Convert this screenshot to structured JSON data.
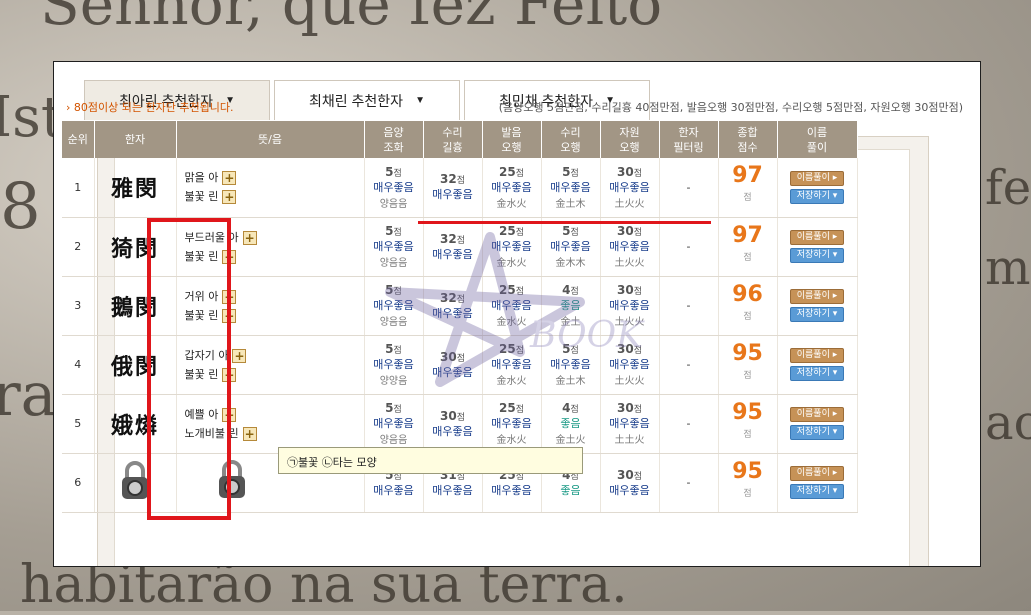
{
  "tabs": [
    {
      "label": "최아린 추천한자",
      "active": true
    },
    {
      "label": "최채린 추천한자",
      "active": false
    },
    {
      "label": "최민채 추천한자",
      "active": false
    }
  ],
  "notice": "› 80점이상 되는 한자단 추천됩니다.",
  "score_note": "(음양오행 5점만점, 수리길흉 40점만점, 발음오행 30점만점, 수리오행 5점만점, 자원오행 30점만점)",
  "headers": {
    "rank": "순위",
    "hanja": "한자",
    "meaning": "뜻/음",
    "c1a": "음양",
    "c1b": "조화",
    "c2a": "수리",
    "c2b": "길흉",
    "c3a": "발음",
    "c3b": "오행",
    "c4a": "수리",
    "c4b": "오행",
    "c5a": "자원",
    "c5b": "오행",
    "c6a": "한자",
    "c6b": "필터링",
    "c7a": "종합",
    "c7b": "점수",
    "c8a": "이름",
    "c8b": "풀이"
  },
  "rows": [
    {
      "rank": "1",
      "hanja": "雅閔",
      "m1": "맑을 아",
      "m2": "불꽃 린",
      "s1": "5",
      "s1l": "매우좋음",
      "s1s": "양음음",
      "s2": "32",
      "s2l": "매우좋음",
      "s2s": "",
      "s3": "25",
      "s3l": "매우좋음",
      "s3s": "金水火",
      "s4": "5",
      "s4l": "매우좋음",
      "s4s": "金土木",
      "s5": "30",
      "s5l": "매우좋음",
      "s5s": "土火火",
      "filter": "-",
      "total": "97"
    },
    {
      "rank": "2",
      "hanja": "猗閔",
      "m1": "부드러울 아",
      "m2": "불꽃 린",
      "s1": "5",
      "s1l": "매우좋음",
      "s1s": "양음음",
      "s2": "32",
      "s2l": "매우좋음",
      "s2s": "",
      "s3": "25",
      "s3l": "매우좋음",
      "s3s": "金水火",
      "s4": "5",
      "s4l": "매우좋음",
      "s4s": "金木木",
      "s5": "30",
      "s5l": "매우좋음",
      "s5s": "土火火",
      "filter": "-",
      "total": "97"
    },
    {
      "rank": "3",
      "hanja": "鵝閔",
      "m1": "거위 아",
      "m2": "불꽃 린",
      "s1": "5",
      "s1l": "매우좋음",
      "s1s": "양음음",
      "s2": "32",
      "s2l": "매우좋음",
      "s2s": "",
      "s3": "25",
      "s3l": "매우좋음",
      "s3s": "金水火",
      "s4": "4",
      "s4l": "좋음",
      "s4s": "金土",
      "s5": "30",
      "s5l": "매우좋음",
      "s5s": "土火火",
      "filter": "-",
      "total": "96"
    },
    {
      "rank": "4",
      "hanja": "俄閔",
      "m1": "갑자기 아",
      "m2": "불꽃 린",
      "s1": "5",
      "s1l": "매우좋음",
      "s1s": "양양음",
      "s2": "30",
      "s2l": "매우좋음",
      "s2s": "",
      "s3": "25",
      "s3l": "매우좋음",
      "s3s": "金水火",
      "s4": "5",
      "s4l": "매우좋음",
      "s4s": "金土木",
      "s5": "30",
      "s5l": "매우좋음",
      "s5s": "土火火",
      "filter": "-",
      "total": "95"
    },
    {
      "rank": "5",
      "hanja": "娥燐",
      "m1": "예쁠 아",
      "m2": "노개비불 린",
      "s1": "5",
      "s1l": "매우좋음",
      "s1s": "양음음",
      "s2": "30",
      "s2l": "매우좋음",
      "s2s": "",
      "s3": "25",
      "s3l": "매우좋음",
      "s3s": "金水火",
      "s4": "4",
      "s4l": "좋음",
      "s4s": "金土火",
      "s5": "30",
      "s5l": "매우좋음",
      "s5s": "土土火",
      "filter": "-",
      "total": "95"
    },
    {
      "rank": "6",
      "hanja": "",
      "m1": "",
      "m2": "",
      "s1": "5",
      "s1l": "매우좋음",
      "s1s": "",
      "s2": "31",
      "s2l": "매우좋음",
      "s2s": "",
      "s3": "25",
      "s3l": "매우좋음",
      "s3s": "",
      "s4": "4",
      "s4l": "좋음",
      "s4s": "",
      "s5": "30",
      "s5l": "매우좋음",
      "s5s": "",
      "filter": "-",
      "total": "95"
    }
  ],
  "point_unit": "점",
  "btn_name": "이름풀이 ▸",
  "btn_save": "저장하기 ▾",
  "tooltip": "㉠불꽃 ㉡타는 모양",
  "watermark_text": "BOOK",
  "background_text": [
    "Senhor, que fez Feito",
    "Isto",
    "8",
    "raç",
    "habitarão na sua terra.",
    "fez",
    "mo",
    "ao"
  ]
}
